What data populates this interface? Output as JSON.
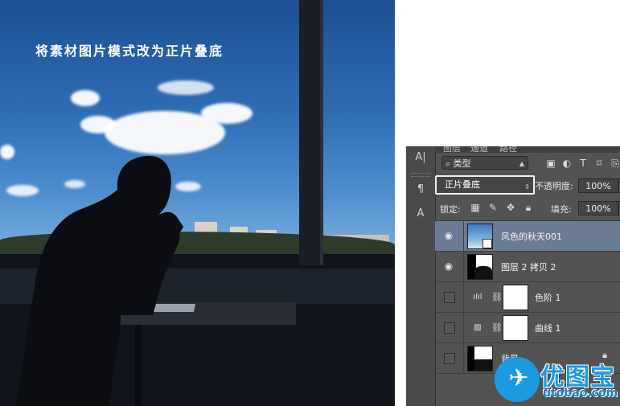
{
  "photo": {
    "caption": "将素材图片模式改为正片叠底"
  },
  "panel": {
    "tabs": [
      "图层",
      "通道",
      "路径"
    ],
    "filter": {
      "label": "类型"
    },
    "blend_mode": "正片叠底",
    "opacity_label": "不透明度:",
    "opacity_value": "100%",
    "lock_label": "锁定:",
    "fill_label": "填充:",
    "fill_value": "100%",
    "layers": [
      {
        "name": "风色的秋天001",
        "visible": true,
        "selected": true
      },
      {
        "name": "图层 2 拷贝 2",
        "visible": true,
        "selected": false
      },
      {
        "name": "色阶 1",
        "visible": false,
        "selected": false,
        "adjustment_icon": "levels-icon"
      },
      {
        "name": "曲线 1",
        "visible": false,
        "selected": false,
        "adjustment_icon": "curves-icon"
      },
      {
        "name": "背景",
        "visible": false,
        "selected": false,
        "locked": true
      }
    ]
  },
  "watermark": {
    "brand_cn": "优图宝",
    "brand_en": "utobao.com",
    "color": "#1a9be0"
  }
}
